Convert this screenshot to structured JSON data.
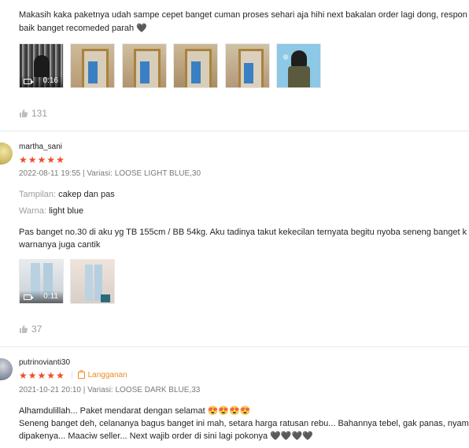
{
  "reviews": [
    {
      "text_lines": [
        "Makasih kaka paketnya udah sampe cepet banget cuman proses sehari aja hihi next bakalan order lagi dong, respon",
        "baik banget recomeded parah 🖤"
      ],
      "media": [
        {
          "type": "video",
          "duration": "0:16"
        },
        {
          "type": "image"
        },
        {
          "type": "image"
        },
        {
          "type": "image"
        },
        {
          "type": "image"
        },
        {
          "type": "image"
        }
      ],
      "likes": "131"
    },
    {
      "username": "martha_sani",
      "rating": 5,
      "meta": "2022-08-11 19:55 | Variasi: LOOSE LIGHT BLUE,30",
      "attrs": [
        {
          "key": "Tampilan:",
          "value": "cakep dan pas"
        },
        {
          "key": "Warna:",
          "value": "light blue"
        }
      ],
      "text_lines": [
        "Pas banget no.30 di aku yg TB 155cm / BB 54kg. Aku tadinya takut kekecilan ternyata begitu nyoba seneng banget k",
        "warnanya juga cantik"
      ],
      "media": [
        {
          "type": "video",
          "duration": "0:11"
        },
        {
          "type": "image"
        }
      ],
      "likes": "37"
    },
    {
      "username": "putrinovianti30",
      "rating": 5,
      "badge": "Langganan",
      "meta": "2021-10-21 20:10 | Variasi: LOOSE DARK BLUE,33",
      "text_lines": [
        "Alhamdulillah... Paket mendarat dengan selamat 😍😍😍😍",
        "Seneng banget deh, celananya bagus banget ini mah, setara harga ratusan rebu... Bahannya tebel, gak panas, nyaman",
        "dipakenya... Maaciw seller... Next wajib order di sini lagi pokonya 🖤🖤🖤🖤"
      ]
    }
  ],
  "colors": {
    "star": "#ee4d2d",
    "badge": "#ee8a24",
    "divider": "#e8e8e8"
  },
  "icons": {
    "like": "thumbs-up-icon",
    "video": "video-camera-icon",
    "star": "star-icon",
    "badge": "shopping-bag-icon"
  }
}
